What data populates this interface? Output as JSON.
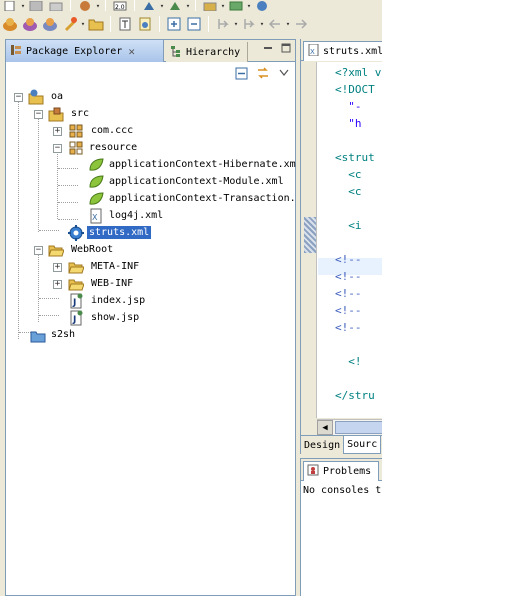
{
  "toolbar_top": {
    "icons": [
      "new-icon",
      "save-icon",
      "print-icon",
      "run-icon",
      "version-icon",
      "perspective-icon",
      "server-icon",
      "web-icon"
    ]
  },
  "toolbar_main": {
    "icons": [
      "open-project-icon",
      "new-package-icon",
      "new-class-icon",
      "tools-icon",
      "open-folder-icon",
      "open-type-icon",
      "open-resource-icon",
      "expand-icon",
      "collapse-icon",
      "next-annotation-icon",
      "prev-annotation-icon",
      "back-icon",
      "forward-icon"
    ]
  },
  "explorer": {
    "tab_label": "Package Explorer",
    "tab_close": "✕",
    "hierarchy_label": "Hierarchy"
  },
  "tree": [
    {
      "label": "oa"
    },
    {
      "label": "src"
    },
    {
      "label": "com.ccc"
    },
    {
      "label": "resource"
    },
    {
      "label": "applicationContext-Hibernate.xml"
    },
    {
      "label": "applicationContext-Module.xml"
    },
    {
      "label": "applicationContext-Transaction.xml"
    },
    {
      "label": "log4j.xml"
    },
    {
      "label": "struts.xml"
    },
    {
      "label": "WebRoot"
    },
    {
      "label": "META-INF"
    },
    {
      "label": "WEB-INF"
    },
    {
      "label": "index.jsp"
    },
    {
      "label": "show.jsp"
    },
    {
      "label": "s2sh"
    }
  ],
  "editor": {
    "tab_label": "struts.xml",
    "lines": [
      {
        "text": "<?xml v"
      },
      {
        "text": "<!DOCT"
      },
      {
        "text": "  \"-"
      },
      {
        "text": "  \"h"
      },
      {
        "text": ""
      },
      {
        "text": "<strut"
      },
      {
        "text": "  <c"
      },
      {
        "text": "  <c"
      },
      {
        "text": ""
      },
      {
        "text": "  <i"
      },
      {
        "text": ""
      },
      {
        "text": "<!--"
      },
      {
        "text": "<!--"
      },
      {
        "text": "<!--"
      },
      {
        "text": "<!--"
      },
      {
        "text": "<!--"
      },
      {
        "text": ""
      },
      {
        "text": "  <!"
      },
      {
        "text": ""
      },
      {
        "text": "</stru"
      }
    ],
    "design_tab": "Design",
    "source_tab": "Sourc"
  },
  "problems": {
    "tab_label": "Problems",
    "message": "No consoles t"
  }
}
